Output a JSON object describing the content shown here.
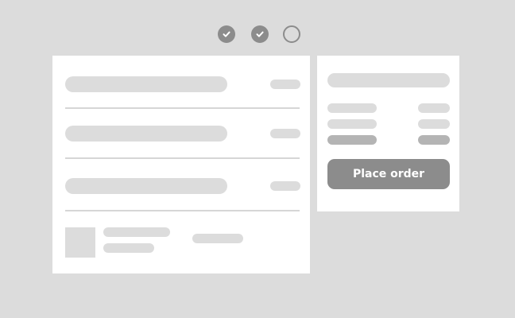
{
  "stepper": {
    "steps": [
      {
        "state": "complete",
        "icon": "check-icon"
      },
      {
        "state": "complete",
        "icon": "check-icon"
      },
      {
        "state": "pending",
        "icon": "empty-circle-icon"
      }
    ]
  },
  "summary": {
    "place_order_label": "Place order"
  },
  "colors": {
    "background": "#dcdcdc",
    "card": "#ffffff",
    "placeholder": "#dcdcdc",
    "placeholder_emphasis": "#b4b4b4",
    "accent_gray": "#8c8c8c"
  }
}
